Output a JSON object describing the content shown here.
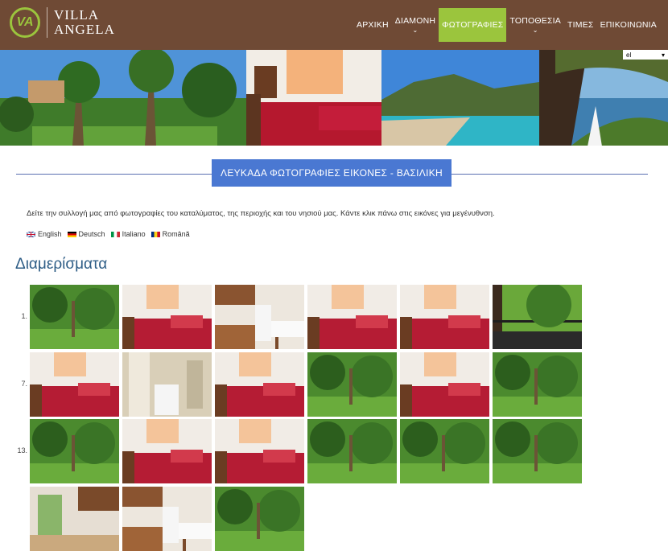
{
  "logo": {
    "line1": "VILLA",
    "line2": "ANGELA",
    "badge": "VA"
  },
  "nav": [
    {
      "label": "ΑΡΧΙΚΗ",
      "dropdown": false,
      "active": false
    },
    {
      "label": "ΔΙΑΜΟΝΗ",
      "dropdown": true,
      "active": false
    },
    {
      "label": "ΦΩΤΟΓΡΑΦΙΕΣ",
      "dropdown": false,
      "active": true
    },
    {
      "label": "ΤΟΠΟΘΕΣΙΑ",
      "dropdown": true,
      "active": false
    },
    {
      "label": "ΤΙΜΕΣ",
      "dropdown": false,
      "active": false
    },
    {
      "label": "ΕΠΙΚΟΙΝΩΝΙΑ",
      "dropdown": false,
      "active": false
    }
  ],
  "language_select": {
    "value": "el"
  },
  "page_title": "ΛΕΥΚΑΔΑ ΦΩΤΟΓΡΑΦΙΕΣ ΕΙΚΟΝΕΣ - ΒΑΣΙΛΙΚΗ",
  "intro": "Δείτε την συλλογή μας από φωτογραφίες του καταλύματος, της περιοχής και του νησιού μας. Κάντε κλικ πάνω στις εικόνες για μεγένυθνση.",
  "languages": [
    {
      "label": "English",
      "flag": "uk-flag"
    },
    {
      "label": "Deutsch",
      "flag": "de-flag"
    },
    {
      "label": "Italiano",
      "flag": "it-flag"
    },
    {
      "label": "Română",
      "flag": "ro-flag"
    }
  ],
  "section_title": "Διαμερίσματα",
  "gallery": {
    "row_numbers": [
      "1.",
      "7.",
      "13."
    ],
    "photos": [
      "garden-photo",
      "bedroom-photo",
      "kitchen-photo",
      "bedroom-photo",
      "bedroom-photo",
      "balcony-photo",
      "bedroom-photo",
      "bathroom-photo",
      "bedroom-photo",
      "garden-photo",
      "bedroom-photo",
      "garden-photo",
      "garden-photo",
      "bedroom-photo",
      "bedroom-photo",
      "garden-photo",
      "garden-photo",
      "garden-photo",
      "room-photo",
      "kitchen-photo",
      "garden-photo"
    ]
  },
  "colors": {
    "header": "#6f4a35",
    "accent": "#9bc53d",
    "title_box": "#4a78d2",
    "section_title": "#2e5d86"
  }
}
